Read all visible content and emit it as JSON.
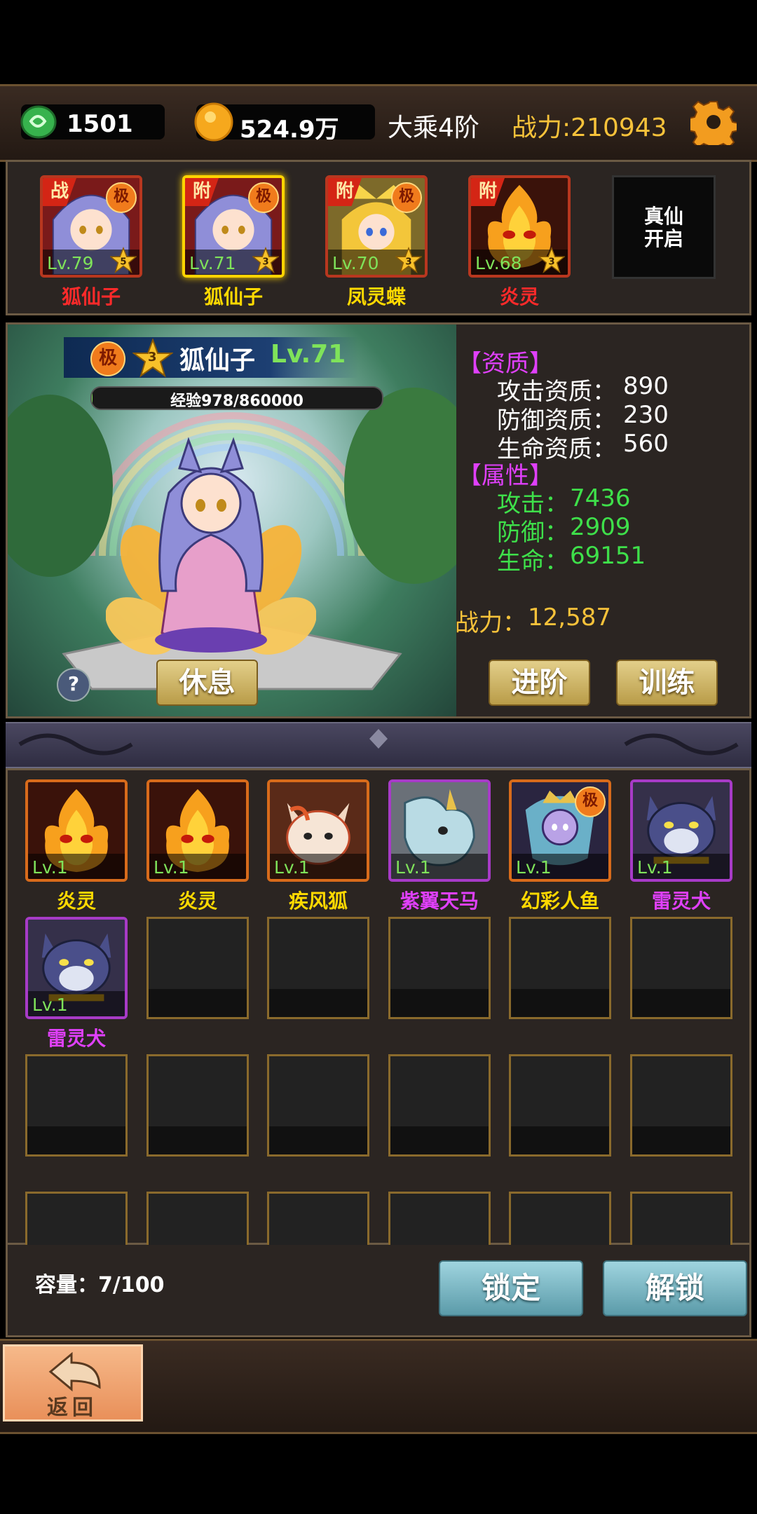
{
  "top_bar": {
    "jade": "1501",
    "gold": "524.9万",
    "realm": "大乘4阶",
    "power": "战力:210943",
    "icons": [
      "jade-icon",
      "gold-coin-icon",
      "gear-icon"
    ]
  },
  "team": [
    {
      "tag": "战",
      "ji": "极",
      "level": "Lv.79",
      "stars": "5",
      "name": "狐仙子",
      "name_color": "#ff2a2a",
      "selected": false
    },
    {
      "tag": "附",
      "ji": "极",
      "level": "Lv.71",
      "stars": "3",
      "name": "狐仙子",
      "name_color": "#ffd900",
      "selected": true
    },
    {
      "tag": "附",
      "ji": "极",
      "level": "Lv.70",
      "stars": "3",
      "name": "凤灵蝶",
      "name_color": "#ffd900",
      "selected": false
    },
    {
      "tag": "附",
      "ji": "",
      "level": "Lv.68",
      "stars": "3",
      "name": "炎灵",
      "name_color": "#ff2a2a",
      "selected": false
    }
  ],
  "true_immortal": {
    "line1": "真仙",
    "line2": "开启"
  },
  "detail": {
    "ji": "极",
    "stars": "3",
    "name": "狐仙子",
    "level": "Lv.71",
    "exp": "经验978/860000",
    "exp_progress": 0.0011,
    "aptitude_header": "【资质】",
    "aptitude": [
      {
        "label": "攻击资质：",
        "value": "890"
      },
      {
        "label": "防御资质：",
        "value": "230"
      },
      {
        "label": "生命资质：",
        "value": "560"
      }
    ],
    "attr_header": "【属性】",
    "attributes": [
      {
        "label": "攻击：",
        "value": "7436"
      },
      {
        "label": "防御：",
        "value": "2909"
      },
      {
        "label": "生命：",
        "value": "69151"
      }
    ],
    "power_label": "战力：",
    "power_value": "12,587",
    "rest_label": "休息",
    "advance_label": "进阶",
    "train_label": "训练",
    "help": "?"
  },
  "bag": [
    {
      "level": "Lv.1",
      "name": "炎灵",
      "name_color": "#ffd900",
      "frame": "orange",
      "art": "flame",
      "ji": ""
    },
    {
      "level": "Lv.1",
      "name": "炎灵",
      "name_color": "#ffd900",
      "frame": "orange",
      "art": "flame",
      "ji": ""
    },
    {
      "level": "Lv.1",
      "name": "疾风狐",
      "name_color": "#ffd900",
      "frame": "orange",
      "art": "fox",
      "ji": ""
    },
    {
      "level": "Lv.1",
      "name": "紫翼天马",
      "name_color": "#e040fb",
      "frame": "purple",
      "art": "dragon",
      "ji": ""
    },
    {
      "level": "Lv.1",
      "name": "幻彩人鱼",
      "name_color": "#ffd900",
      "frame": "orange",
      "art": "mermaid",
      "ji": "极"
    },
    {
      "level": "Lv.1",
      "name": "雷灵犬",
      "name_color": "#e040fb",
      "frame": "purple",
      "art": "dog",
      "ji": ""
    },
    {
      "level": "Lv.1",
      "name": "雷灵犬",
      "name_color": "#e040fb",
      "frame": "purple",
      "art": "dog",
      "ji": ""
    }
  ],
  "capacity": "容量：7/100",
  "lock_label": "锁定",
  "unlock_label": "解锁",
  "back_label": "返回"
}
